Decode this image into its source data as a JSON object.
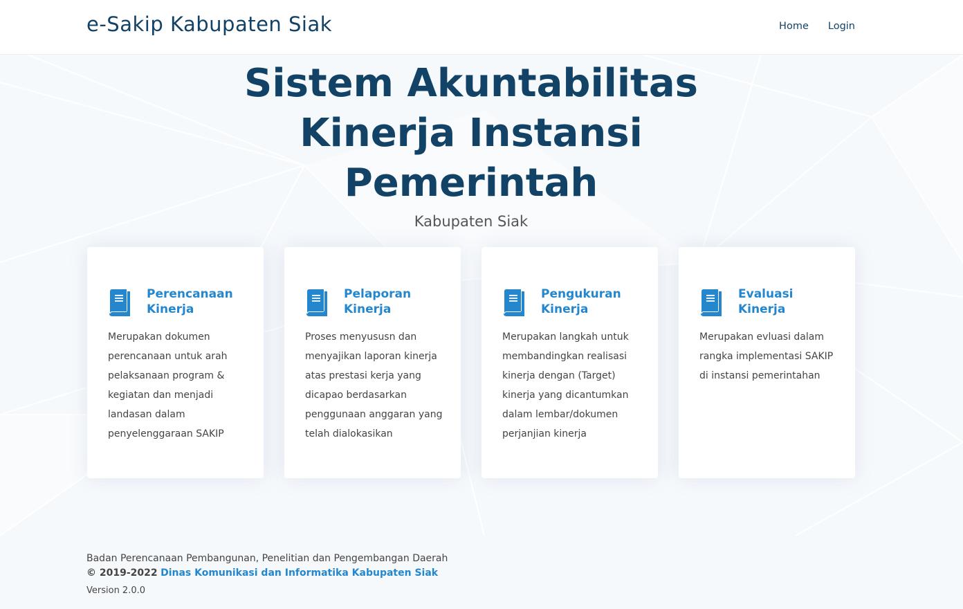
{
  "header": {
    "brand": "e-Sakip Kabupaten Siak",
    "nav": [
      {
        "label": "Home"
      },
      {
        "label": "Login"
      }
    ]
  },
  "hero": {
    "title": "Sistem Akuntabilitas Kinerja Instansi Pemerintah",
    "subtitle": "Kabupaten Siak"
  },
  "cards": [
    {
      "icon": "book-icon",
      "title": "Perencanaan Kinerja",
      "description": "Merupakan dokumen perencanaan untuk arah pelaksanaan program & kegiatan dan menjadi landasan dalam penyelenggaraan SAKIP"
    },
    {
      "icon": "book-icon",
      "title": "Pelaporan Kinerja",
      "description": "Proses menyususn dan menyajikan laporan kinerja atas prestasi kerja yang dicapao berdasarkan penggunaan anggaran yang telah dialokasikan"
    },
    {
      "icon": "book-icon",
      "title": "Pengukuran Kinerja",
      "description": "Merupakan langkah untuk membandingkan realisasi kinerja dengan (Target) kinerja yang dicantumkan dalam lembar/dokumen perjanjian kinerja"
    },
    {
      "icon": "book-icon",
      "title": "Evaluasi Kinerja",
      "description": "Merupakan evluasi dalam rangka implementasi SAKIP di instansi pemerintahan"
    }
  ],
  "footer": {
    "agency": "Badan Perencanaan Pembangunan, Penelitian dan Pengembangan Daerah",
    "copyright": "© 2019-2022",
    "link_text": "Dinas Komunikasi dan Informatika Kabupaten Siak",
    "version": "Version 2.0.0"
  },
  "colors": {
    "primary_dark": "#124265",
    "accent": "#2487ce",
    "background": "#f6f9fc",
    "text": "#444444"
  }
}
